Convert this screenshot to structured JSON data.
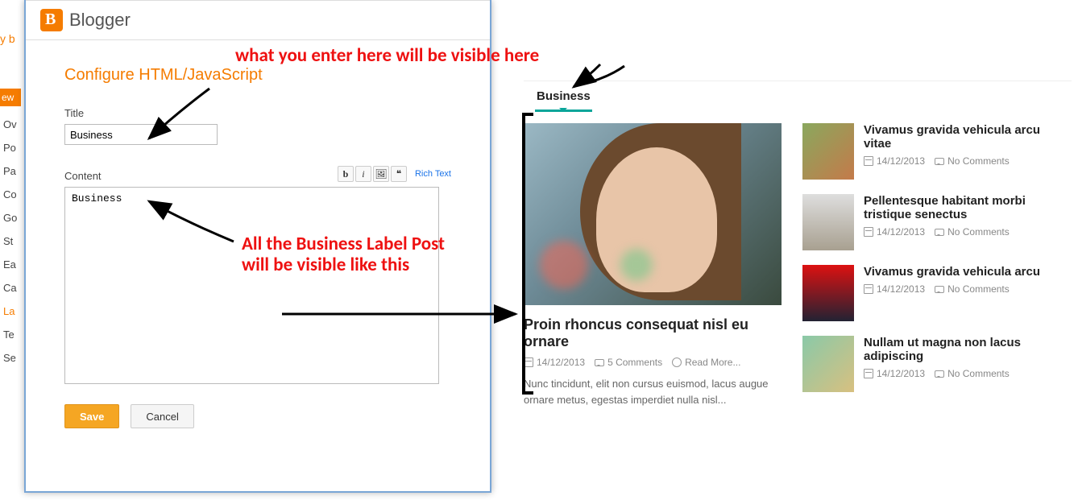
{
  "bg": {
    "brand_fragment": "y b",
    "new_post_fragment": "ew p",
    "nav": [
      "Ov",
      "Po",
      "Pa",
      "Co",
      "Go",
      "St",
      "Ea",
      "Ca",
      "La",
      "Te",
      "Se"
    ],
    "active_index": 8
  },
  "dialog": {
    "brand": "Blogger",
    "heading": "Configure HTML/JavaScript",
    "title_label": "Title",
    "title_value": "Business",
    "content_label": "Content",
    "richtext_link": "Rich Text",
    "content_value": "Business",
    "save": "Save",
    "cancel": "Cancel",
    "toolbar": {
      "bold": "b",
      "italic": "i",
      "image": "🖼",
      "quote": "❝"
    }
  },
  "preview": {
    "tab": "Business",
    "main": {
      "title": "Proin rhoncus consequat nisl eu ornare",
      "date": "14/12/2013",
      "comments": "5 Comments",
      "readmore": "Read More...",
      "excerpt": "Nunc tincidunt, elit non cursus euismod, lacus augue ornare metus, egestas imperdiet nulla nisl..."
    },
    "side": [
      {
        "title": "Vivamus gravida vehicula arcu vitae",
        "date": "14/12/2013",
        "comments": "No Comments"
      },
      {
        "title": "Pellentesque habitant morbi tristique senectus",
        "date": "14/12/2013",
        "comments": "No Comments"
      },
      {
        "title": "Vivamus gravida vehicula arcu",
        "date": "14/12/2013",
        "comments": "No Comments"
      },
      {
        "title": "Nullam ut magna non lacus adipiscing",
        "date": "14/12/2013",
        "comments": "No Comments"
      }
    ]
  },
  "annotations": {
    "top": "what you enter here will be visible here",
    "mid": "All the Business Label Post will be visible like this"
  }
}
